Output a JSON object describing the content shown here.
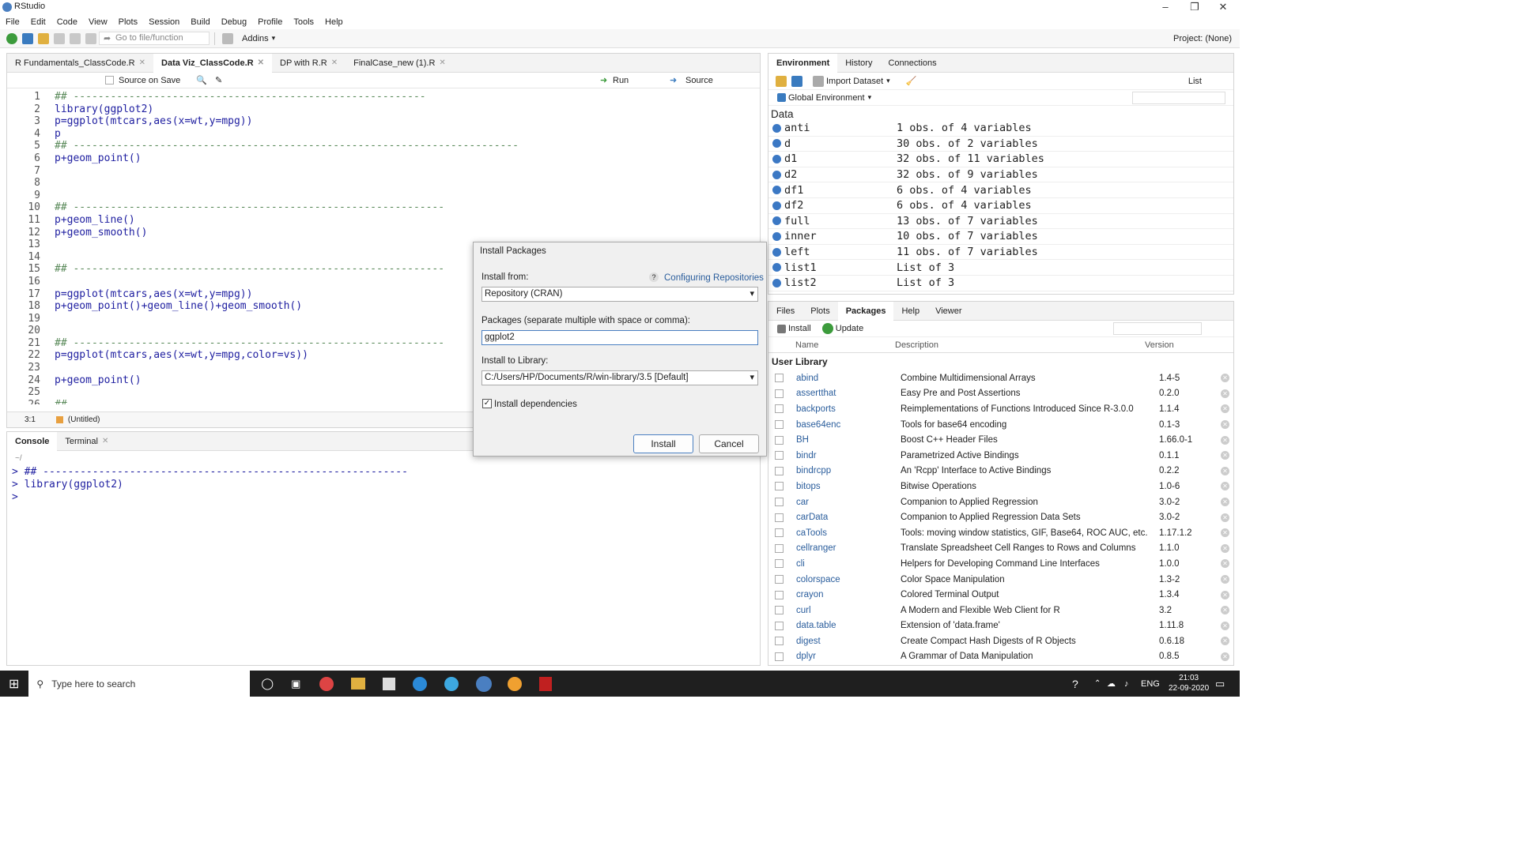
{
  "window": {
    "title": "RStudio"
  },
  "menu": [
    "File",
    "Edit",
    "Code",
    "View",
    "Plots",
    "Session",
    "Build",
    "Debug",
    "Profile",
    "Tools",
    "Help"
  ],
  "toolbar": {
    "goto_placeholder": "Go to file/function",
    "addins": "Addins",
    "project": "Project: (None)"
  },
  "editor": {
    "tabs": [
      "R Fundamentals_ClassCode.R",
      "Data Viz_ClassCode.R",
      "DP with R.R",
      "FinalCase_new (1).R"
    ],
    "active_tab": 1,
    "source_on_save": "Source on Save",
    "run": "Run",
    "source": "Source",
    "lines": [
      {
        "n": "1",
        "text": "## ---------------------------------------------------------"
      },
      {
        "n": "2",
        "text": "library(ggplot2)"
      },
      {
        "n": "3",
        "text": "p=ggplot(mtcars,aes(x=wt,y=mpg))"
      },
      {
        "n": "4",
        "text": "p"
      },
      {
        "n": "5",
        "text": "## ------------------------------------------------------------------------"
      },
      {
        "n": "6",
        "text": "p+geom_point()"
      },
      {
        "n": "7",
        "text": ""
      },
      {
        "n": "8",
        "text": ""
      },
      {
        "n": "9",
        "text": ""
      },
      {
        "n": "10",
        "text": "## ------------------------------------------------------------"
      },
      {
        "n": "11",
        "text": "p+geom_line()"
      },
      {
        "n": "12",
        "text": "p+geom_smooth()"
      },
      {
        "n": "13",
        "text": ""
      },
      {
        "n": "14",
        "text": ""
      },
      {
        "n": "15",
        "text": "## ------------------------------------------------------------"
      },
      {
        "n": "16",
        "text": ""
      },
      {
        "n": "17",
        "text": "p=ggplot(mtcars,aes(x=wt,y=mpg))"
      },
      {
        "n": "18",
        "text": "p+geom_point()+geom_line()+geom_smooth()"
      },
      {
        "n": "19",
        "text": ""
      },
      {
        "n": "20",
        "text": ""
      },
      {
        "n": "21",
        "text": "## ------------------------------------------------------------"
      },
      {
        "n": "22",
        "text": "p=ggplot(mtcars,aes(x=wt,y=mpg,color=vs))"
      },
      {
        "n": "23",
        "text": ""
      },
      {
        "n": "24",
        "text": "p+geom_point()"
      },
      {
        "n": "25",
        "text": ""
      },
      {
        "n": "26",
        "text": "##"
      }
    ],
    "status_pos": "3:1",
    "status_scope": "(Untitled)"
  },
  "console": {
    "tabs": [
      "Console",
      "Terminal"
    ],
    "path": "~/",
    "lines": [
      "> ## -----------------------------------------------------------",
      "> library(ggplot2)",
      "> "
    ]
  },
  "environment": {
    "tabs": [
      "Environment",
      "History",
      "Connections"
    ],
    "import_dataset": "Import Dataset",
    "view_mode": "List",
    "scope": "Global Environment",
    "section": "Data",
    "rows": [
      {
        "name": "anti",
        "value": "1 obs. of 4 variables"
      },
      {
        "name": "d",
        "value": "30 obs. of 2 variables"
      },
      {
        "name": "d1",
        "value": "32 obs. of 11 variables"
      },
      {
        "name": "d2",
        "value": "32 obs. of 9 variables"
      },
      {
        "name": "df1",
        "value": "6 obs. of 4 variables"
      },
      {
        "name": "df2",
        "value": "6 obs. of 4 variables"
      },
      {
        "name": "full",
        "value": "13 obs. of 7 variables"
      },
      {
        "name": "inner",
        "value": "10 obs. of 7 variables"
      },
      {
        "name": "left",
        "value": "11 obs. of 7 variables"
      },
      {
        "name": "list1",
        "value": "List of 3"
      },
      {
        "name": "list2",
        "value": "List of 3"
      }
    ]
  },
  "packages": {
    "tabs": [
      "Files",
      "Plots",
      "Packages",
      "Help",
      "Viewer"
    ],
    "install": "Install",
    "update": "Update",
    "columns": [
      "Name",
      "Description",
      "Version"
    ],
    "section": "User Library",
    "rows": [
      {
        "name": "abind",
        "desc": "Combine Multidimensional Arrays",
        "ver": "1.4-5"
      },
      {
        "name": "assertthat",
        "desc": "Easy Pre and Post Assertions",
        "ver": "0.2.0"
      },
      {
        "name": "backports",
        "desc": "Reimplementations of Functions Introduced Since R-3.0.0",
        "ver": "1.1.4"
      },
      {
        "name": "base64enc",
        "desc": "Tools for base64 encoding",
        "ver": "0.1-3"
      },
      {
        "name": "BH",
        "desc": "Boost C++ Header Files",
        "ver": "1.66.0-1"
      },
      {
        "name": "bindr",
        "desc": "Parametrized Active Bindings",
        "ver": "0.1.1"
      },
      {
        "name": "bindrcpp",
        "desc": "An 'Rcpp' Interface to Active Bindings",
        "ver": "0.2.2"
      },
      {
        "name": "bitops",
        "desc": "Bitwise Operations",
        "ver": "1.0-6"
      },
      {
        "name": "car",
        "desc": "Companion to Applied Regression",
        "ver": "3.0-2"
      },
      {
        "name": "carData",
        "desc": "Companion to Applied Regression Data Sets",
        "ver": "3.0-2"
      },
      {
        "name": "caTools",
        "desc": "Tools: moving window statistics, GIF, Base64, ROC AUC, etc.",
        "ver": "1.17.1.2"
      },
      {
        "name": "cellranger",
        "desc": "Translate Spreadsheet Cell Ranges to Rows and Columns",
        "ver": "1.1.0"
      },
      {
        "name": "cli",
        "desc": "Helpers for Developing Command Line Interfaces",
        "ver": "1.0.0"
      },
      {
        "name": "colorspace",
        "desc": "Color Space Manipulation",
        "ver": "1.3-2"
      },
      {
        "name": "crayon",
        "desc": "Colored Terminal Output",
        "ver": "1.3.4"
      },
      {
        "name": "curl",
        "desc": "A Modern and Flexible Web Client for R",
        "ver": "3.2"
      },
      {
        "name": "data.table",
        "desc": "Extension of 'data.frame'",
        "ver": "1.11.8"
      },
      {
        "name": "digest",
        "desc": "Create Compact Hash Digests of R Objects",
        "ver": "0.6.18"
      },
      {
        "name": "dplyr",
        "desc": "A Grammar of Data Manipulation",
        "ver": "0.8.5"
      }
    ]
  },
  "dialog": {
    "title": "Install Packages",
    "install_from_label": "Install from:",
    "configuring_link": "Configuring Repositories",
    "install_from_value": "Repository (CRAN)",
    "packages_label": "Packages (separate multiple with space or comma):",
    "packages_value": "ggplot2",
    "library_label": "Install to Library:",
    "library_value": "C:/Users/HP/Documents/R/win-library/3.5 [Default]",
    "deps_label": "Install dependencies",
    "install_btn": "Install",
    "cancel_btn": "Cancel"
  },
  "taskbar": {
    "search": "Type here to search",
    "lang": "ENG",
    "time": "21:03",
    "date": "22-09-2020"
  },
  "colors": {
    "accent": "#2a5d9c",
    "taskbar": "#1f1f1f"
  }
}
